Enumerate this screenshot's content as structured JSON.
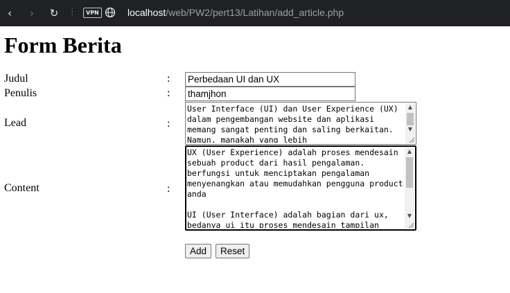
{
  "browser": {
    "back_icon": "‹",
    "forward_icon": "›",
    "reload_icon": "↻",
    "dots": "⋮",
    "vpn_label": "VPN",
    "url_host": "localhost",
    "url_path": "/web/PW2/pert13/Latihan/add_article.php"
  },
  "page": {
    "title": "Form Berita"
  },
  "form": {
    "fields": [
      {
        "label": "Judul",
        "colon": ":",
        "value": "Perbedaan UI dan UX"
      },
      {
        "label": "Penulis",
        "colon": ":",
        "value": "thamjhon"
      },
      {
        "label": "Lead",
        "colon": ":",
        "value": "User Interface (UI) dan User Experience (UX) dalam pengembangan website dan aplikasi memang sangat penting dan saling berkaitan. Namun, manakah yang lebih"
      },
      {
        "label": "Content",
        "colon": ":",
        "value": "UX (User Experience) adalah proses mendesain sebuah product dari hasil pengalaman. berfungsi untuk menciptakan pengalaman menyenangkan atau memudahkan pengguna product anda\n\nUI (User Interface) adalah bagian dari ux, bedanya ui itu proses mendesain tampilan"
      }
    ],
    "add_label": "Add",
    "reset_label": "Reset"
  }
}
